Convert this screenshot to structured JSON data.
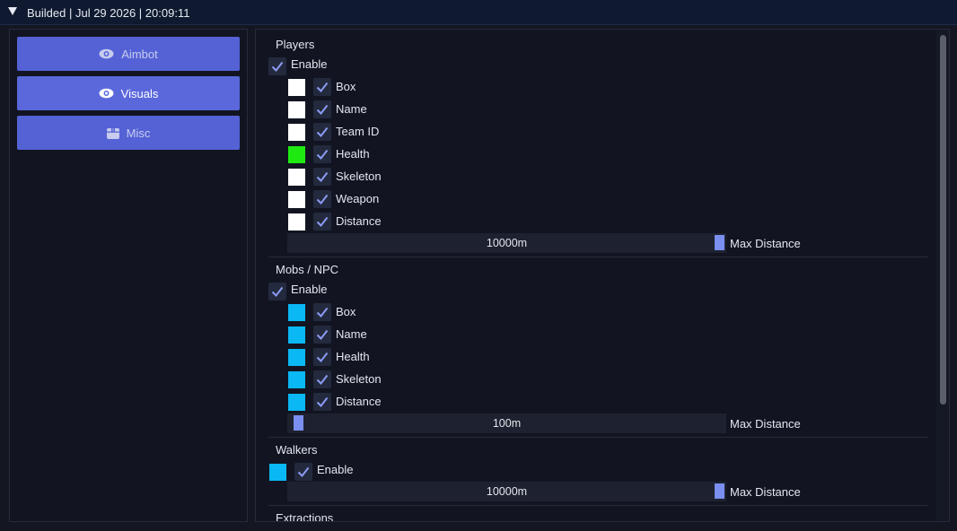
{
  "window": {
    "title": "Builded | Jul 29 2026 | 20:09:11"
  },
  "nav": [
    {
      "label": "Aimbot",
      "icon": "eye-icon"
    },
    {
      "label": "Visuals",
      "icon": "eye-icon"
    },
    {
      "label": "Misc",
      "icon": "box-icon"
    }
  ],
  "players": {
    "title": "Players",
    "enable": "Enable",
    "items": [
      {
        "label": "Box",
        "color": "#ffffff"
      },
      {
        "label": "Name",
        "color": "#ffffff"
      },
      {
        "label": "Team ID",
        "color": "#ffffff"
      },
      {
        "label": "Health",
        "color": "#1eea12"
      },
      {
        "label": "Skeleton",
        "color": "#ffffff"
      },
      {
        "label": "Weapon",
        "color": "#ffffff"
      },
      {
        "label": "Distance",
        "color": "#ffffff"
      }
    ],
    "slider_value": "10000m",
    "slider_label": "Max Distance"
  },
  "mobs": {
    "title": "Mobs / NPC",
    "enable": "Enable",
    "items": [
      {
        "label": "Box",
        "color": "#0ab8f4"
      },
      {
        "label": "Name",
        "color": "#0ab8f4"
      },
      {
        "label": "Health",
        "color": "#0ab8f4"
      },
      {
        "label": "Skeleton",
        "color": "#0ab8f4"
      },
      {
        "label": "Distance",
        "color": "#0ab8f4"
      }
    ],
    "slider_value": "100m",
    "slider_label": "Max Distance"
  },
  "walkers": {
    "title": "Walkers",
    "enable": "Enable",
    "color": "#0ab8f4",
    "slider_value": "10000m",
    "slider_label": "Max Distance"
  },
  "extractions": {
    "title": "Extractions"
  }
}
